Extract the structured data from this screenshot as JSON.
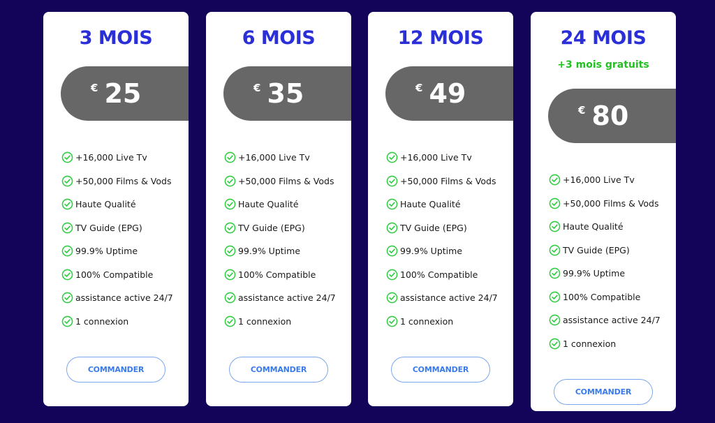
{
  "colors": {
    "background": "#13045a",
    "title": "#2a2fd8",
    "bonus": "#22c021",
    "price_pill": "#676767",
    "check": "#2ecc40",
    "button": "#3a7bea"
  },
  "plans": [
    {
      "title": "3 MOIS",
      "bonus": null,
      "currency": "€",
      "price": "25",
      "features": [
        "+16,000 Live Tv",
        "+50,000 Films & Vods",
        "Haute Qualité",
        "TV Guide (EPG)",
        "99.9% Uptime",
        "100% Compatible",
        "assistance active 24/7",
        "1 connexion"
      ],
      "feature_icon": "check-circle-icon",
      "button_label": "COMMANDER"
    },
    {
      "title": "6 MOIS",
      "bonus": null,
      "currency": "€",
      "price": "35",
      "features": [
        "+16,000 Live Tv",
        "+50,000 Films & Vods",
        "Haute Qualité",
        "TV Guide (EPG)",
        "99.9% Uptime",
        "100% Compatible",
        "assistance active 24/7",
        "1 connexion"
      ],
      "feature_icon": "check-circle-icon",
      "button_label": "COMMANDER"
    },
    {
      "title": "12 MOIS",
      "bonus": null,
      "currency": "€",
      "price": "49",
      "features": [
        "+16,000 Live Tv",
        "+50,000 Films & Vods",
        "Haute Qualité",
        "TV Guide (EPG)",
        "99.9% Uptime",
        "100% Compatible",
        "assistance active 24/7",
        "1 connexion"
      ],
      "feature_icon": "check-circle-icon",
      "button_label": "COMMANDER"
    },
    {
      "title": "24 MOIS",
      "bonus": "+3 mois gratuits",
      "currency": "€",
      "price": "80",
      "features": [
        "+16,000 Live Tv",
        "+50,000 Films & Vods",
        "Haute Qualité",
        "TV Guide (EPG)",
        "99.9% Uptime",
        "100% Compatible",
        "assistance active 24/7",
        "1 connexion"
      ],
      "feature_icon": "check-circle-icon",
      "button_label": "COMMANDER"
    }
  ]
}
